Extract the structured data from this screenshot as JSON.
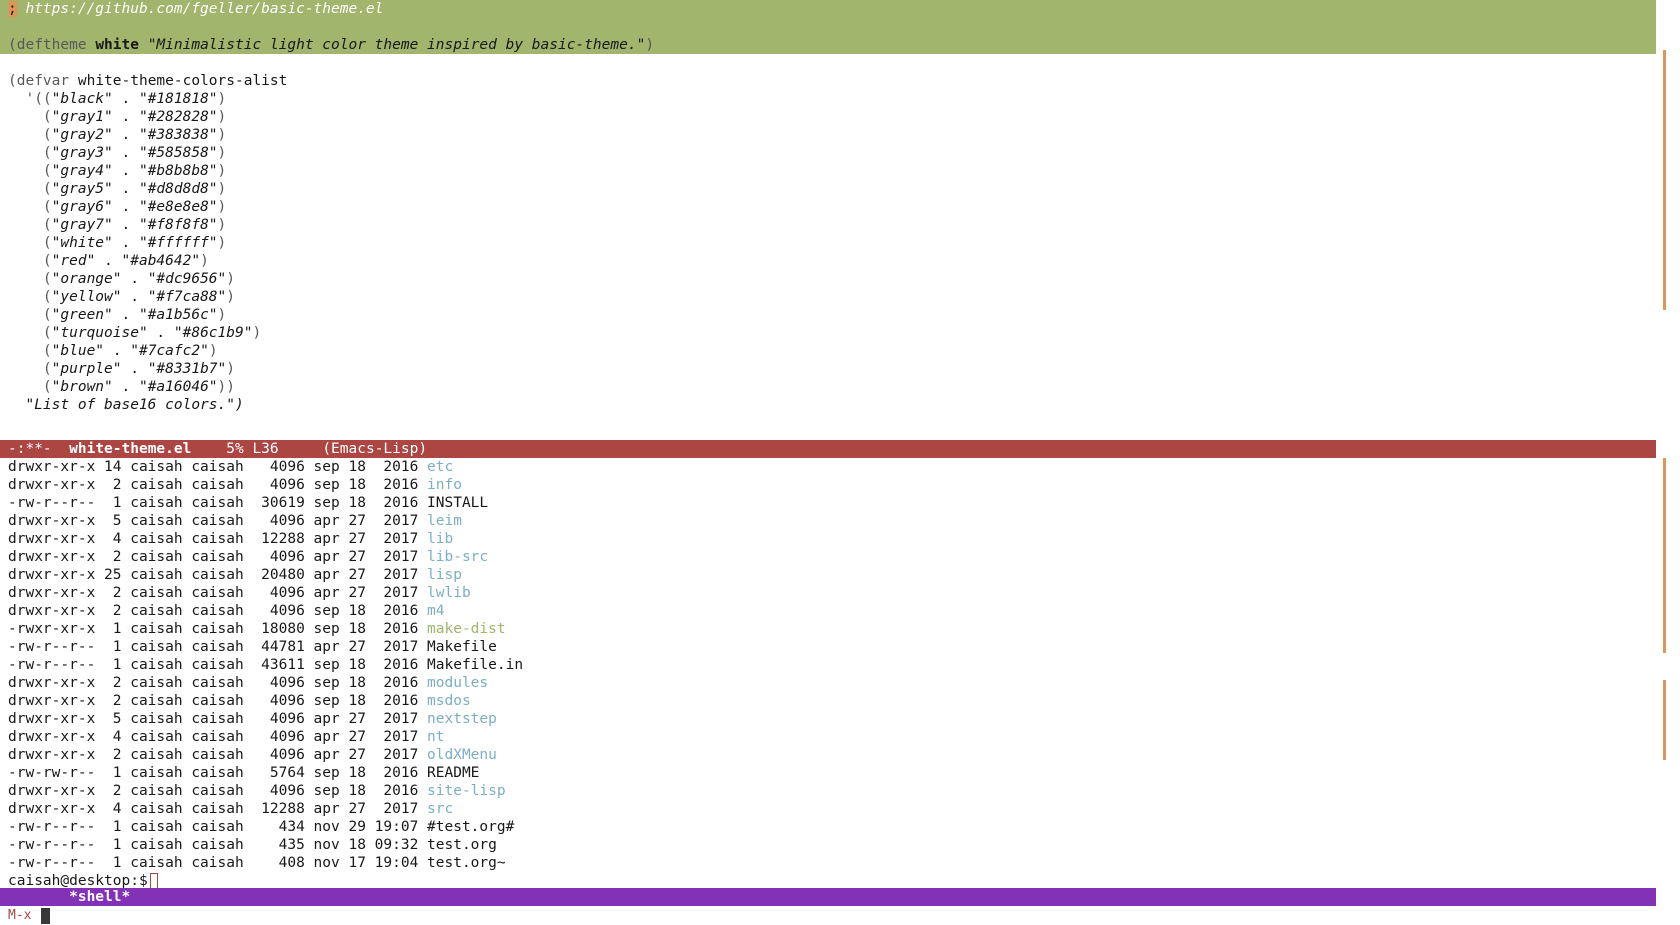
{
  "editor": {
    "lines": [
      {
        "type": "comment",
        "text": "; https://github.com/fgeller/basic-theme.el"
      },
      {
        "type": "blank"
      },
      {
        "type": "deftheme",
        "kw": "deftheme",
        "name": "white",
        "doc": "\"Minimalistic light color theme inspired by basic-theme.\""
      },
      {
        "type": "blank"
      },
      {
        "type": "defvar",
        "kw": "defvar",
        "name": "white-theme-colors-alist"
      },
      {
        "type": "pair",
        "prefix": "  '((",
        "key": "\"black\"",
        "val": "\"#181818\"",
        "suffix": ")"
      },
      {
        "type": "pair",
        "prefix": "    (",
        "key": "\"gray1\"",
        "val": "\"#282828\"",
        "suffix": ")"
      },
      {
        "type": "pair",
        "prefix": "    (",
        "key": "\"gray2\"",
        "val": "\"#383838\"",
        "suffix": ")"
      },
      {
        "type": "pair",
        "prefix": "    (",
        "key": "\"gray3\"",
        "val": "\"#585858\"",
        "suffix": ")"
      },
      {
        "type": "pair",
        "prefix": "    (",
        "key": "\"gray4\"",
        "val": "\"#b8b8b8\"",
        "suffix": ")"
      },
      {
        "type": "pair",
        "prefix": "    (",
        "key": "\"gray5\"",
        "val": "\"#d8d8d8\"",
        "suffix": ")"
      },
      {
        "type": "pair",
        "prefix": "    (",
        "key": "\"gray6\"",
        "val": "\"#e8e8e8\"",
        "suffix": ")"
      },
      {
        "type": "pair",
        "prefix": "    (",
        "key": "\"gray7\"",
        "val": "\"#f8f8f8\"",
        "suffix": ")"
      },
      {
        "type": "pair",
        "prefix": "    (",
        "key": "\"white\"",
        "val": "\"#ffffff\"",
        "suffix": ")"
      },
      {
        "type": "pair",
        "prefix": "    (",
        "key": "\"red\"",
        "val": "\"#ab4642\"",
        "suffix": ")"
      },
      {
        "type": "pair",
        "prefix": "    (",
        "key": "\"orange\"",
        "val": "\"#dc9656\"",
        "suffix": ")"
      },
      {
        "type": "pair",
        "prefix": "    (",
        "key": "\"yellow\"",
        "val": "\"#f7ca88\"",
        "suffix": ")"
      },
      {
        "type": "pair",
        "prefix": "    (",
        "key": "\"green\"",
        "val": "\"#a1b56c\"",
        "suffix": ")"
      },
      {
        "type": "pair",
        "prefix": "    (",
        "key": "\"turquoise\"",
        "val": "\"#86c1b9\"",
        "suffix": ")"
      },
      {
        "type": "pair",
        "prefix": "    (",
        "key": "\"blue\"",
        "val": "\"#7cafc2\"",
        "suffix": ")"
      },
      {
        "type": "pair",
        "prefix": "    (",
        "key": "\"purple\"",
        "val": "\"#8331b7\"",
        "suffix": ")"
      },
      {
        "type": "pair",
        "prefix": "    (",
        "key": "\"brown\"",
        "val": "\"#a16046\"",
        "suffix": "))"
      },
      {
        "type": "docstr",
        "text": "  \"List of base16 colors.\")"
      }
    ],
    "modeline": {
      "state": "-:**-",
      "buffer": "white-theme.el",
      "position": "5% L36",
      "mode": "(Emacs-Lisp)"
    }
  },
  "shell": {
    "listing": [
      {
        "perm": "drwxr-xr-x",
        "links": "14",
        "user": "caisah",
        "group": "caisah",
        "size": "4096",
        "mon": "sep",
        "day": "18",
        "time": "2016",
        "name": "etc",
        "kind": "dir"
      },
      {
        "perm": "drwxr-xr-x",
        "links": "2",
        "user": "caisah",
        "group": "caisah",
        "size": "4096",
        "mon": "sep",
        "day": "18",
        "time": "2016",
        "name": "info",
        "kind": "dir"
      },
      {
        "perm": "-rw-r--r--",
        "links": "1",
        "user": "caisah",
        "group": "caisah",
        "size": "30619",
        "mon": "sep",
        "day": "18",
        "time": "2016",
        "name": "INSTALL",
        "kind": "file"
      },
      {
        "perm": "drwxr-xr-x",
        "links": "5",
        "user": "caisah",
        "group": "caisah",
        "size": "4096",
        "mon": "apr",
        "day": "27",
        "time": "2017",
        "name": "leim",
        "kind": "dir"
      },
      {
        "perm": "drwxr-xr-x",
        "links": "4",
        "user": "caisah",
        "group": "caisah",
        "size": "12288",
        "mon": "apr",
        "day": "27",
        "time": "2017",
        "name": "lib",
        "kind": "dir"
      },
      {
        "perm": "drwxr-xr-x",
        "links": "2",
        "user": "caisah",
        "group": "caisah",
        "size": "4096",
        "mon": "apr",
        "day": "27",
        "time": "2017",
        "name": "lib-src",
        "kind": "dir"
      },
      {
        "perm": "drwxr-xr-x",
        "links": "25",
        "user": "caisah",
        "group": "caisah",
        "size": "20480",
        "mon": "apr",
        "day": "27",
        "time": "2017",
        "name": "lisp",
        "kind": "dir"
      },
      {
        "perm": "drwxr-xr-x",
        "links": "2",
        "user": "caisah",
        "group": "caisah",
        "size": "4096",
        "mon": "apr",
        "day": "27",
        "time": "2017",
        "name": "lwlib",
        "kind": "dir"
      },
      {
        "perm": "drwxr-xr-x",
        "links": "2",
        "user": "caisah",
        "group": "caisah",
        "size": "4096",
        "mon": "sep",
        "day": "18",
        "time": "2016",
        "name": "m4",
        "kind": "dir"
      },
      {
        "perm": "-rwxr-xr-x",
        "links": "1",
        "user": "caisah",
        "group": "caisah",
        "size": "18080",
        "mon": "sep",
        "day": "18",
        "time": "2016",
        "name": "make-dist",
        "kind": "exec"
      },
      {
        "perm": "-rw-r--r--",
        "links": "1",
        "user": "caisah",
        "group": "caisah",
        "size": "44781",
        "mon": "apr",
        "day": "27",
        "time": "2017",
        "name": "Makefile",
        "kind": "file"
      },
      {
        "perm": "-rw-r--r--",
        "links": "1",
        "user": "caisah",
        "group": "caisah",
        "size": "43611",
        "mon": "sep",
        "day": "18",
        "time": "2016",
        "name": "Makefile.in",
        "kind": "file"
      },
      {
        "perm": "drwxr-xr-x",
        "links": "2",
        "user": "caisah",
        "group": "caisah",
        "size": "4096",
        "mon": "sep",
        "day": "18",
        "time": "2016",
        "name": "modules",
        "kind": "dir"
      },
      {
        "perm": "drwxr-xr-x",
        "links": "2",
        "user": "caisah",
        "group": "caisah",
        "size": "4096",
        "mon": "sep",
        "day": "18",
        "time": "2016",
        "name": "msdos",
        "kind": "dir"
      },
      {
        "perm": "drwxr-xr-x",
        "links": "5",
        "user": "caisah",
        "group": "caisah",
        "size": "4096",
        "mon": "apr",
        "day": "27",
        "time": "2017",
        "name": "nextstep",
        "kind": "dir"
      },
      {
        "perm": "drwxr-xr-x",
        "links": "4",
        "user": "caisah",
        "group": "caisah",
        "size": "4096",
        "mon": "apr",
        "day": "27",
        "time": "2017",
        "name": "nt",
        "kind": "dir"
      },
      {
        "perm": "drwxr-xr-x",
        "links": "2",
        "user": "caisah",
        "group": "caisah",
        "size": "4096",
        "mon": "apr",
        "day": "27",
        "time": "2017",
        "name": "oldXMenu",
        "kind": "dir"
      },
      {
        "perm": "-rw-rw-r--",
        "links": "1",
        "user": "caisah",
        "group": "caisah",
        "size": "5764",
        "mon": "sep",
        "day": "18",
        "time": "2016",
        "name": "README",
        "kind": "file"
      },
      {
        "perm": "drwxr-xr-x",
        "links": "2",
        "user": "caisah",
        "group": "caisah",
        "size": "4096",
        "mon": "sep",
        "day": "18",
        "time": "2016",
        "name": "site-lisp",
        "kind": "dir"
      },
      {
        "perm": "drwxr-xr-x",
        "links": "4",
        "user": "caisah",
        "group": "caisah",
        "size": "12288",
        "mon": "apr",
        "day": "27",
        "time": "2017",
        "name": "src",
        "kind": "dir"
      },
      {
        "perm": "-rw-r--r--",
        "links": "1",
        "user": "caisah",
        "group": "caisah",
        "size": "434",
        "mon": "nov",
        "day": "29",
        "time": "19:07",
        "name": "#test.org#",
        "kind": "file"
      },
      {
        "perm": "-rw-r--r--",
        "links": "1",
        "user": "caisah",
        "group": "caisah",
        "size": "435",
        "mon": "nov",
        "day": "18",
        "time": "09:32",
        "name": "test.org",
        "kind": "file"
      },
      {
        "perm": "-rw-r--r--",
        "links": "1",
        "user": "caisah",
        "group": "caisah",
        "size": "408",
        "mon": "nov",
        "day": "17",
        "time": "19:04",
        "name": "test.org~",
        "kind": "file"
      }
    ],
    "prompt": "caisah@desktop:$",
    "modeline": {
      "buffer": "*shell*"
    }
  },
  "minibuffer": {
    "text": "M-x"
  },
  "colors": {
    "highlight": "#a1b56c",
    "modeline_active": "#ab4642",
    "modeline_shell": "#8331b7",
    "directory": "#7cafc2",
    "executable": "#a1b56c"
  }
}
